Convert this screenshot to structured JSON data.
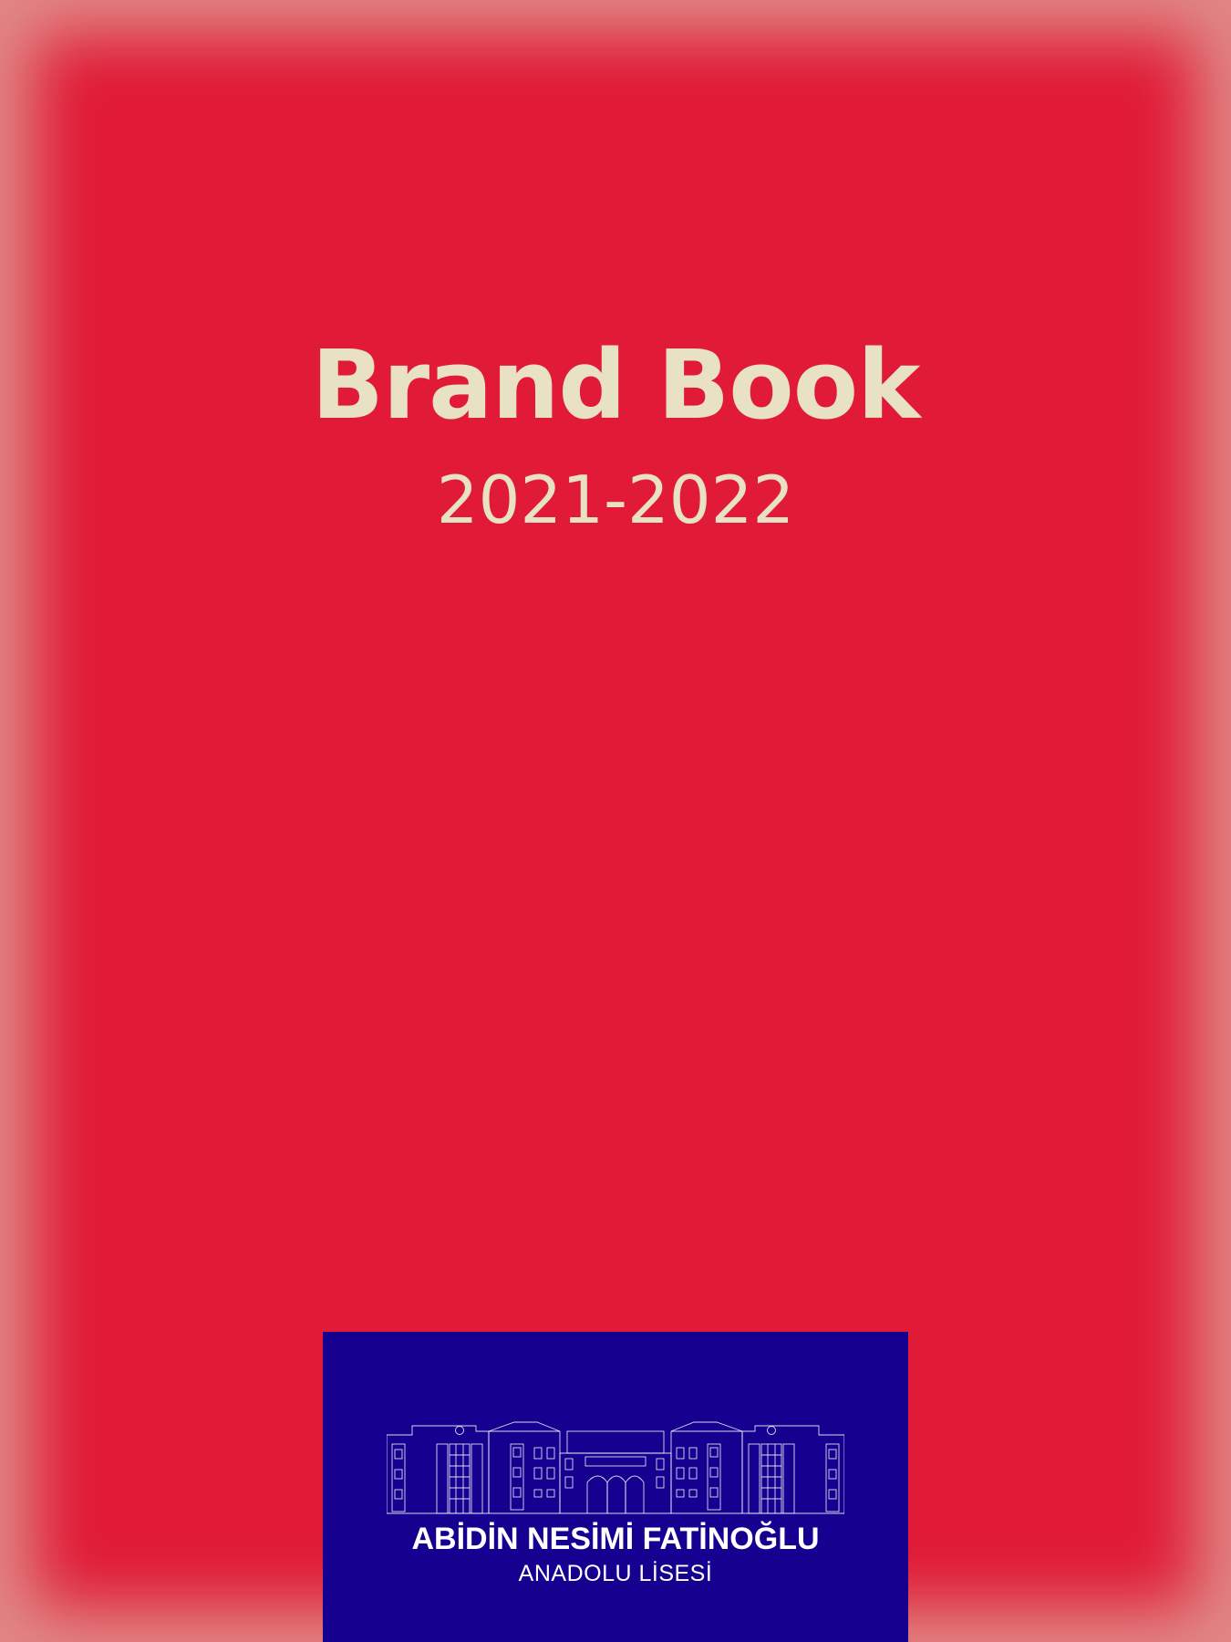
{
  "cover": {
    "title": "Brand Book",
    "years": "2021-2022"
  },
  "logo": {
    "name": "ABİDİN NESİMİ FATİNOĞLU",
    "type": "ANADOLU LİSESİ",
    "icon": "school-building-icon"
  },
  "colors": {
    "cover_red": "#e01a37",
    "text_cream": "#e8e1c4",
    "logo_blue": "#150090",
    "outer_pink": "#e08a86"
  }
}
